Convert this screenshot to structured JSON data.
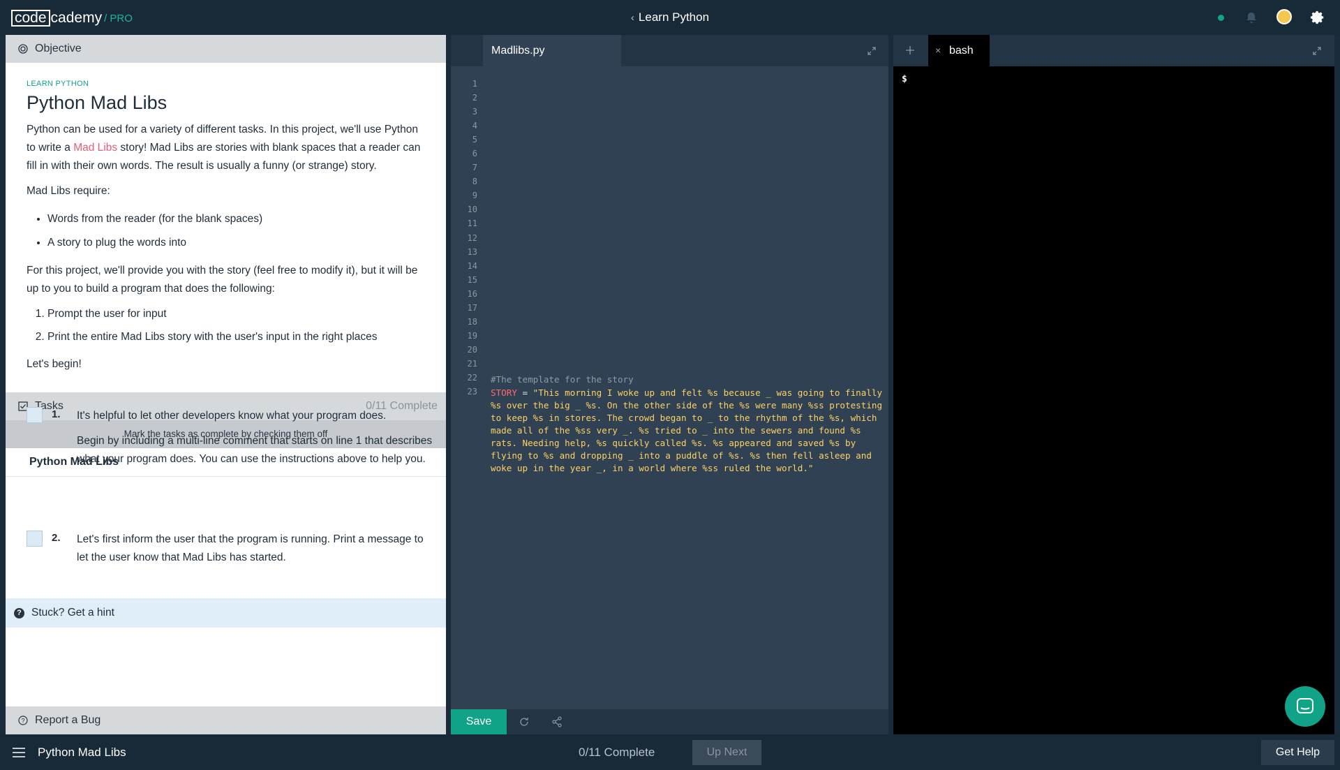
{
  "header": {
    "logo_box": "code",
    "logo_rest": "cademy",
    "logo_pro": "/ PRO",
    "course_title": "Learn Python"
  },
  "objective": {
    "header": "Objective",
    "eyebrow": "LEARN PYTHON",
    "title": "Python Mad Libs",
    "intro_before_link": "Python can be used for a variety of different tasks. In this project, we'll use Python to write a ",
    "intro_link": "Mad Libs",
    "intro_after_link": " story! Mad Libs are stories with blank spaces that a reader can fill in with their own words. The result is usually a funny (or strange) story.",
    "requires": "Mad Libs require:",
    "bullets": [
      "Words from the reader (for the blank spaces)",
      "A story to plug the words into"
    ],
    "project_text": "For this project, we'll provide you with the story (feel free to modify it), but it will be up to you to build a program that does the following:",
    "steps": [
      "Prompt the user for input",
      "Print the entire Mad Libs story with the user's input in the right places"
    ],
    "closing": "Let's begin!"
  },
  "tasks": {
    "header": "Tasks",
    "count": "0/11 Complete",
    "note": "Mark the tasks as complete by checking them off",
    "group_title": "Python Mad Libs",
    "items": [
      {
        "num": "1.",
        "text": "It's helpful to let other developers know what your program does.",
        "detail": "Begin by including a multi-line comment that starts on line 1 that describes what your program does. You can use the instructions above to help you."
      },
      {
        "num": "2.",
        "text": "Let's first inform the user that the program is running. Print a message to let the user know that Mad Libs has started."
      }
    ],
    "hint": "Stuck? Get a hint",
    "report": "Report a Bug"
  },
  "editor": {
    "filename": "Madlibs.py",
    "line_numbers": [
      "1",
      "2",
      "3",
      "4",
      "5",
      "6",
      "7",
      "8",
      "9",
      "10",
      "11",
      "12",
      "13",
      "14",
      "15",
      "16",
      "17",
      "18",
      "19",
      "20",
      "21",
      "22",
      "23"
    ],
    "comment": "#The template for the story",
    "story_var": "STORY",
    "story_op": " = ",
    "story_string": "\"This morning I woke up and felt %s because _ was going to finally %s over the big _ %s. On the other side of the %s were many %ss protesting to keep %s in stores. The crowd began to _ to the rhythm of the %s, which made all of the %ss very _. %s tried to _ into the sewers and found %s rats. Needing help, %s quickly called %s. %s appeared and saved %s by flying to %s and dropping _ into a puddle of %s. %s then fell asleep and woke up in the year _, in a world where %ss ruled the world.\"",
    "save_label": "Save"
  },
  "terminal": {
    "tab_label": "bash",
    "close_glyph": "×",
    "prompt": "$"
  },
  "footer": {
    "title": "Python Mad Libs",
    "progress": "0/11 Complete",
    "up_next": "Up Next",
    "get_help": "Get Help"
  },
  "colors": {
    "brand_green": "#10a388",
    "link_red": "#e85d75",
    "string_yellow": "#ffd166",
    "navy": "#182938"
  }
}
